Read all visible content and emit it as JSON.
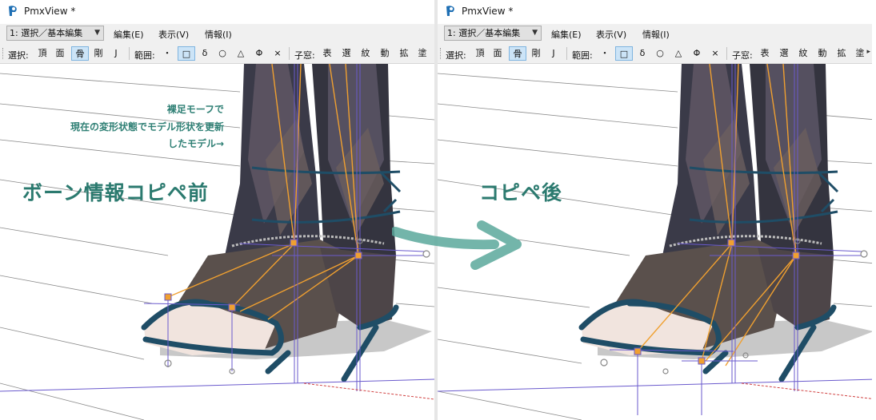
{
  "window_title": "PmxView *",
  "mode_select": "1: 選択／基本編集",
  "menus": [
    "編集(E)",
    "表示(V)",
    "情報(I)"
  ],
  "toolbar": {
    "select_label": "選択:",
    "select_items": [
      "頂",
      "面",
      "骨",
      "剛",
      "J"
    ],
    "range_label": "範囲:",
    "range_items": [
      "・",
      "□",
      "δ",
      "○",
      "△",
      "Φ",
      "×"
    ],
    "child_label": "子窓:",
    "child_items": [
      "表",
      "選",
      "紋",
      "動",
      "拡",
      "塗"
    ],
    "overflow": "▸"
  },
  "annotations": {
    "note_line1": "裸足モーフで",
    "note_line2": "現在の変形状態でモデル形状を更新",
    "note_line3": "したモデル→",
    "before_label": "ボーン情報コピペ前",
    "after_label": "コピペ後"
  },
  "colors": {
    "annotation": "#2b7a6f",
    "arrow": "#5aa89b",
    "bone_orange": "#f0a030",
    "bone_purple": "#6a5acd",
    "ribbon": "#1f4d66",
    "stocking": "#3a3a48"
  }
}
